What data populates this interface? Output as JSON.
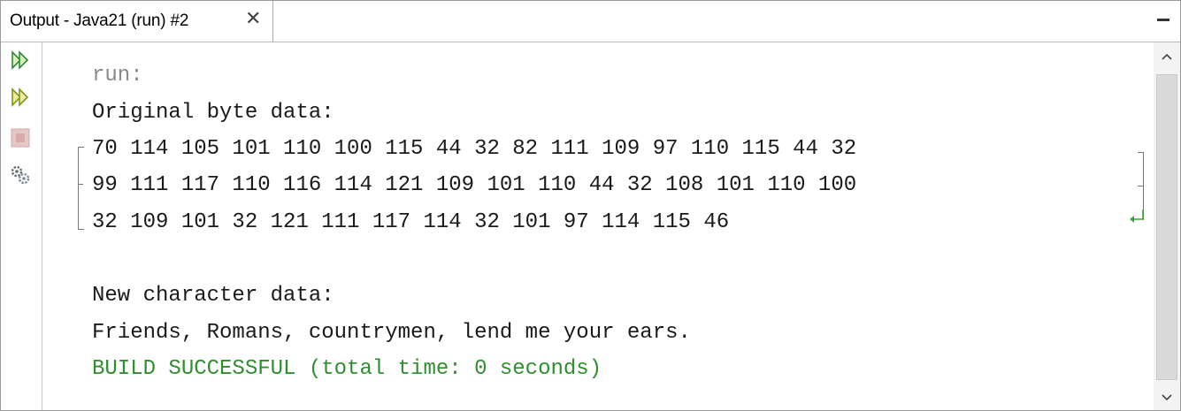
{
  "tab": {
    "title": "Output - Java21 (run) #2",
    "close_glyph": "✕"
  },
  "toolbar": {
    "buttons": [
      {
        "icon": "rerun-icon"
      },
      {
        "icon": "rerun-with-options-icon"
      },
      {
        "icon": "stop-icon"
      },
      {
        "icon": "settings-icon"
      }
    ]
  },
  "output": {
    "lines": [
      "run:",
      "Original byte data:",
      "70 114 105 101 110 100 115 44 32 82 111 109 97 110 115 44 32",
      "99 111 117 110 116 114 121 109 101 110 44 32 108 101 110 100",
      "32 109 101 32 121 111 117 114 32 101 97 114 115 46",
      "",
      "New character data:",
      "Friends, Romans, countrymen, lend me your ears.",
      "BUILD SUCCESSFUL (total time: 0 seconds)"
    ]
  },
  "colors": {
    "success": "#2f8f2f",
    "run_label": "#8a8a8a",
    "rerun_green": "#3aa63a"
  }
}
